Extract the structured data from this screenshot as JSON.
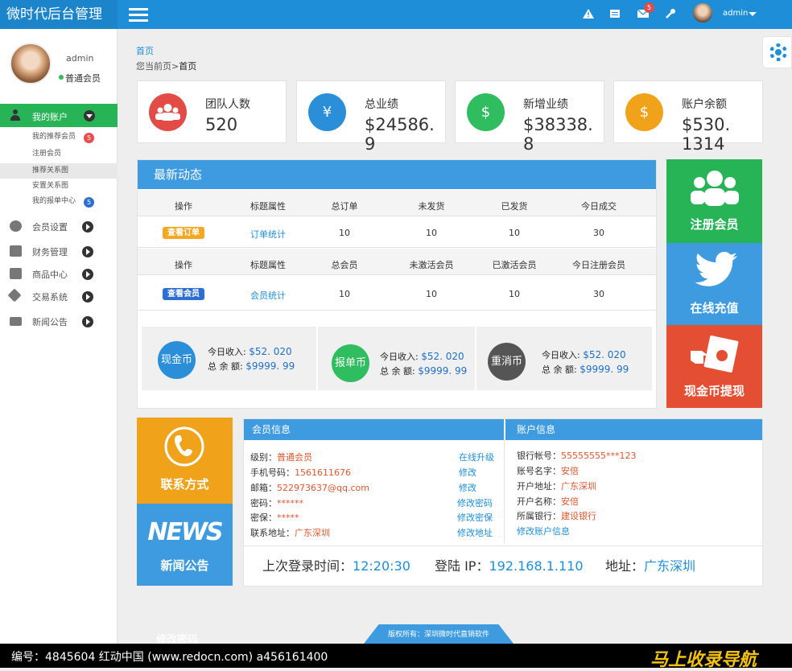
{
  "app": {
    "title": "微时代后台管理",
    "top_badge": "5",
    "user": "admin"
  },
  "sidebar": {
    "username": "admin",
    "role": "普通会员",
    "active": {
      "label": "我的账户"
    },
    "subs": [
      {
        "label": "我的推荐会员",
        "badge": "5"
      },
      {
        "label": "注册会员"
      },
      {
        "label": "推荐关系图"
      },
      {
        "label": "安置关系图"
      },
      {
        "label": "我的报单中心",
        "badge": "5"
      }
    ],
    "items": [
      {
        "label": "会员设置"
      },
      {
        "label": "财务管理"
      },
      {
        "label": "商品中心"
      },
      {
        "label": "交易系统"
      },
      {
        "label": "新闻公告"
      }
    ]
  },
  "breadcrumb": {
    "home": "首页",
    "prefix": "您当前页>",
    "current": "首页"
  },
  "stats": [
    {
      "title": "团队人数",
      "value": "520",
      "color": "#e34b47"
    },
    {
      "title": "总业绩",
      "value": "$24586. 9",
      "color": "#2a8fd8",
      "glyph": "¥"
    },
    {
      "title": "新增业绩",
      "value": "$38338. 8",
      "color": "#2fbd5f",
      "glyph": "$"
    },
    {
      "title": "账户余额",
      "value": "$530. 1314",
      "color": "#f0a21a",
      "glyph": "$"
    }
  ],
  "news": {
    "title": "最新动态",
    "table1": {
      "headers": [
        "操作",
        "标题属性",
        "总订单",
        "未发货",
        "已发货",
        "今日成交"
      ],
      "row": {
        "action": "查看订单",
        "link": "订单统计",
        "values": [
          "10",
          "10",
          "10",
          "30"
        ]
      }
    },
    "table2": {
      "headers": [
        "操作",
        "标题属性",
        "总会员",
        "未激活会员",
        "已激活会员",
        "今日注册会员"
      ],
      "row": {
        "action": "查看会员",
        "link": "会员统计",
        "values": [
          "10",
          "10",
          "10",
          "30"
        ]
      }
    },
    "coins": [
      {
        "name": "现金币",
        "color": "#2a8fd8",
        "income_label": "今日收入:",
        "income": "$52. 020",
        "total_label": "总 余 额:",
        "total": "$9999. 99"
      },
      {
        "name": "报单币",
        "color": "#2fbd5f",
        "income_label": "今日收入:",
        "income": "$52. 020",
        "total_label": "总 余 额:",
        "total": "$9999. 99"
      },
      {
        "name": "重消币",
        "color": "#555555",
        "income_label": "今日收入:",
        "income": "$52. 020",
        "total_label": "总 余 额:",
        "total": "$9999. 99"
      }
    ]
  },
  "tiles": {
    "register": "注册会员",
    "recharge": "在线充值",
    "withdraw": "现金币提现",
    "contact": "联系方式",
    "news_word": "NEWS",
    "news": "新闻公告"
  },
  "member": {
    "title": "会员信息",
    "rows": [
      {
        "label": "级别：",
        "value": "普通会员",
        "link": "在线升级"
      },
      {
        "label": "手机号码：",
        "value": "1561611676",
        "link": "修改"
      },
      {
        "label": "邮箱：",
        "value": "522973637@qq.com",
        "link": "修改"
      },
      {
        "label": "密码：",
        "value": "******",
        "link": "修改密码"
      },
      {
        "label": "密保：",
        "value": "*****",
        "link": "修改密保"
      },
      {
        "label": "联系地址：",
        "value": "广东深圳",
        "link": "修改地址"
      }
    ]
  },
  "account": {
    "title": "账户信息",
    "rows": [
      {
        "label": "银行帐号：",
        "value": "55555555***123"
      },
      {
        "label": "账号名字：",
        "value": "安倍"
      },
      {
        "label": "开户地址：",
        "value": "广东深圳"
      },
      {
        "label": "开户名称：",
        "value": "安倍"
      },
      {
        "label": "所属银行：",
        "value": "建设银行"
      }
    ],
    "link": "修改账户信息"
  },
  "login": {
    "time_label": "上次登录时间：",
    "time": "12:20:30",
    "ip_label": "登陆 IP：",
    "ip": "192.168.1.110",
    "addr_label": "地址：",
    "addr": "广东深圳"
  },
  "footer": {
    "copyright": "版权所有：深圳微时代直销软件",
    "ghost": "修改密码"
  },
  "watermark": {
    "left": "编号：4845604   红动中国 (www.redocn.com)   a456161400",
    "right": "马上收录导航"
  }
}
